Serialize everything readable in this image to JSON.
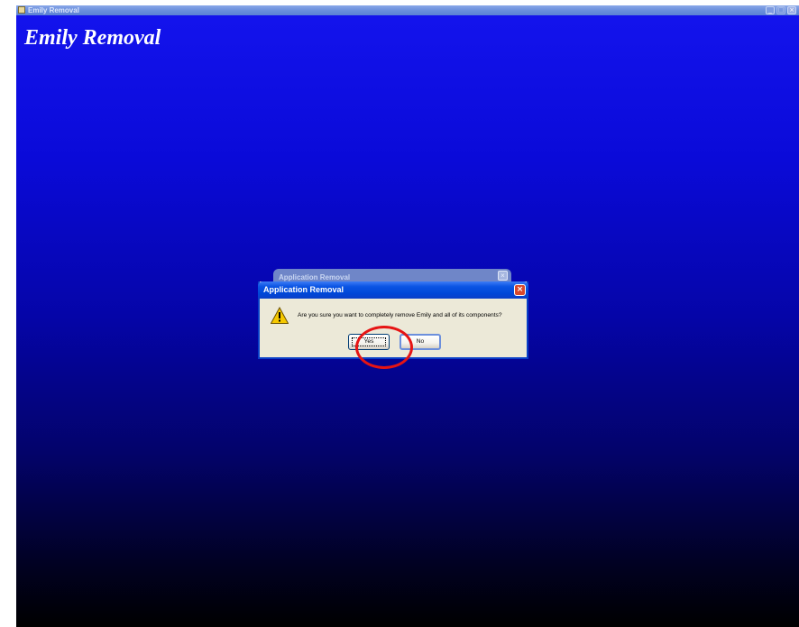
{
  "window": {
    "title": "Emily Removal",
    "heading": "Emily Removal",
    "icon": "app-icon",
    "controls": {
      "minimize": "_",
      "maximize": "□",
      "close": "×"
    }
  },
  "background_dialog": {
    "title": "Application Removal",
    "close": "×"
  },
  "dialog": {
    "title": "Application Removal",
    "close": "×",
    "icon": "warning-icon",
    "message": "Are you sure you want to completely remove Emily and all of its components?",
    "yes_label": "Yes",
    "no_label": "No"
  },
  "colors": {
    "annotation": "#e61414",
    "dialog_titlebar": "#0047d8",
    "dialog_body": "#ece9d8"
  }
}
